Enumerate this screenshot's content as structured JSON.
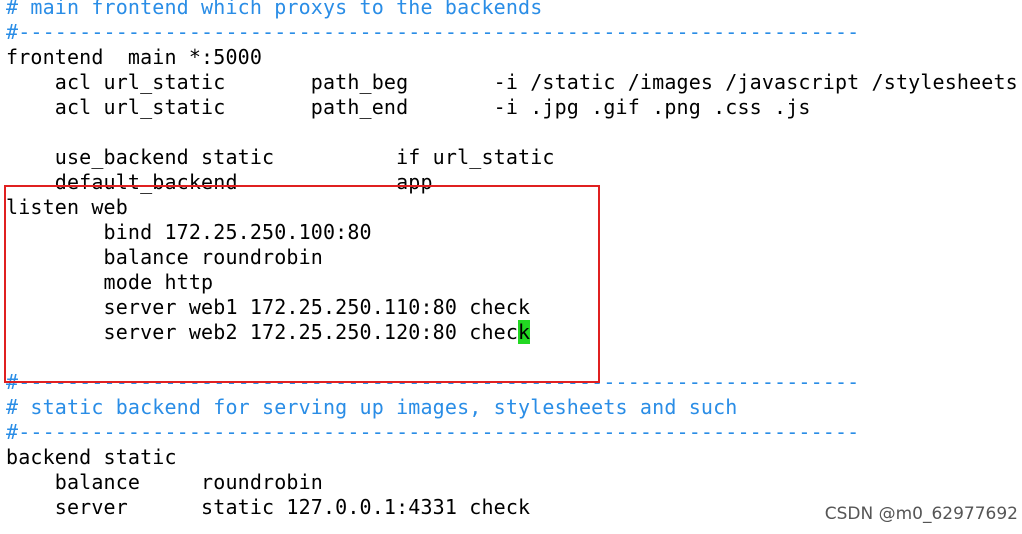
{
  "editor": {
    "lines": [
      "# main frontend which proxys to the backends",
      "#---------------------------------------------------------------------",
      "frontend  main *:5000",
      "    acl url_static       path_beg       -i /static /images /javascript /stylesheets",
      "    acl url_static       path_end       -i .jpg .gif .png .css .js",
      "",
      "    use_backend static          if url_static",
      "    default_backend             app",
      "listen web",
      "        bind 172.25.250.100:80",
      "        balance roundrobin",
      "        mode http",
      "        server web1 172.25.250.110:80 check",
      "        server web2 172.25.250.120:80 chec",
      "",
      "#---------------------------------------------------------------------",
      "# static backend for serving up images, stylesheets and such",
      "#---------------------------------------------------------------------",
      "backend static",
      "    balance     roundrobin",
      "    server      static 127.0.0.1:4331 check"
    ],
    "cursor_char": "k",
    "cursor_line_index": 13,
    "comment_color": "#2a8de6",
    "cursor_color": "#22d822",
    "highlight_color": "#e02020"
  },
  "watermark": "CSDN @m0_62977692"
}
